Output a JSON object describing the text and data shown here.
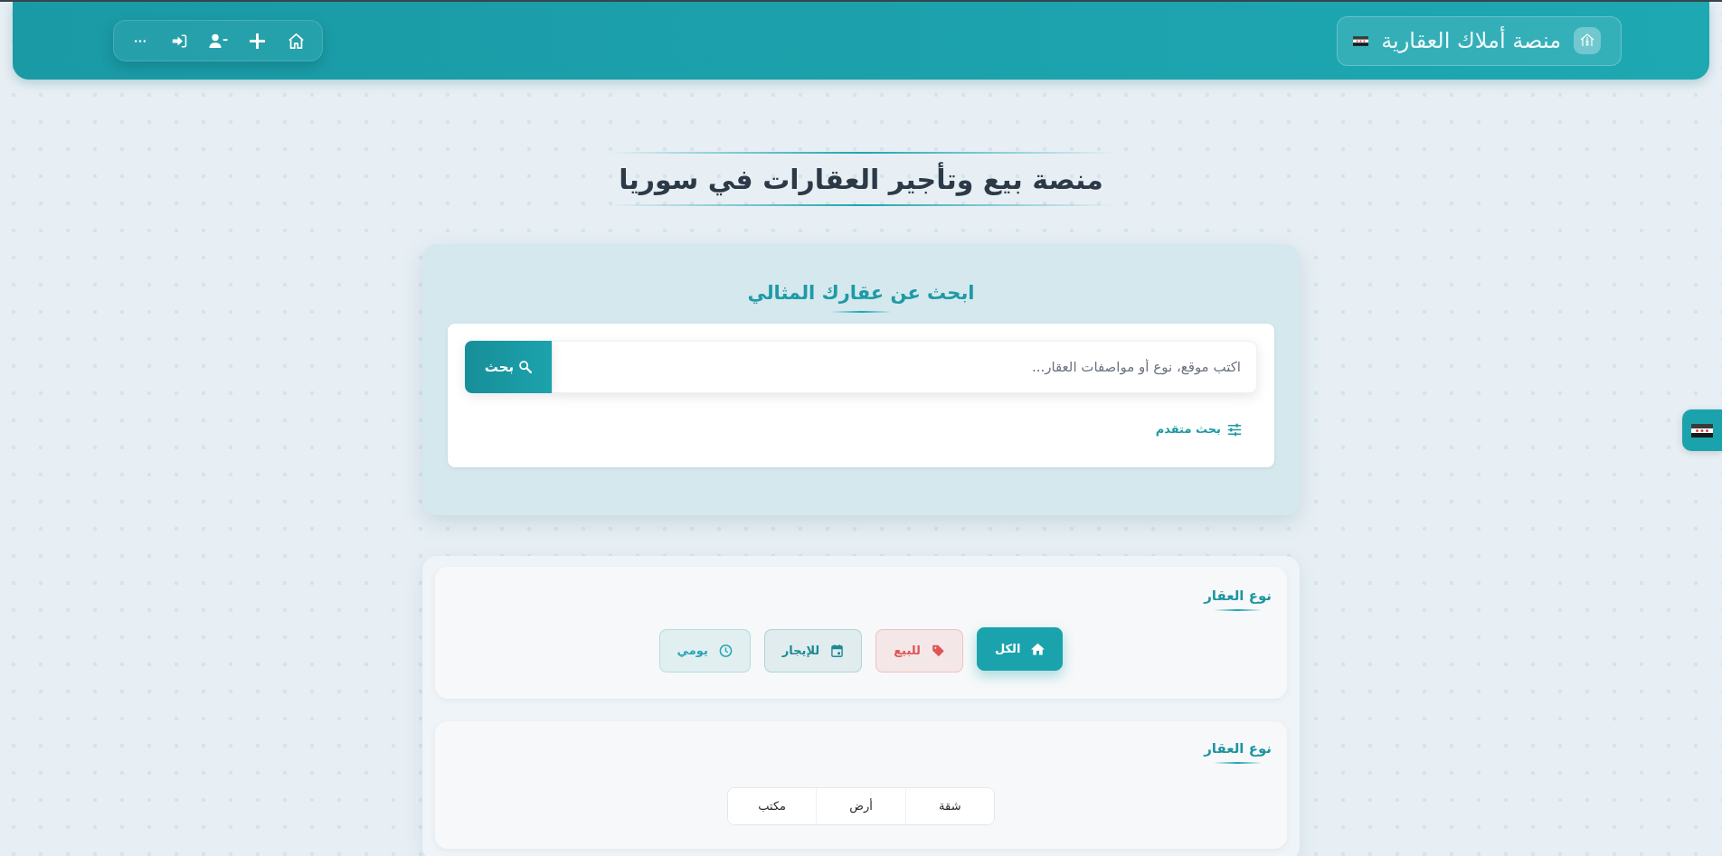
{
  "header": {
    "brand": "منصة أملاك العقارية"
  },
  "hero": {
    "title": "منصة بيع وتأجير العقارات في سوريا"
  },
  "search": {
    "heading": "ابحث عن عقارك المثالي",
    "placeholder": "اكتب موقع، نوع أو مواصفات العقار...",
    "button": "بحث",
    "advanced": "بحث متقدم"
  },
  "filters": [
    {
      "kind": "chips",
      "heading": "نوع العقار",
      "options": [
        {
          "label": "الكل",
          "selected": true,
          "color": "#1ba3ad"
        },
        {
          "label": "للبيع",
          "selected": false,
          "color": "#e05555"
        },
        {
          "label": "للإيجار",
          "selected": false,
          "color": "#1f8a95"
        },
        {
          "label": "يومي",
          "selected": false,
          "color": "#2aa5b5"
        }
      ]
    },
    {
      "kind": "segmented",
      "heading": "نوع العقار",
      "options": [
        {
          "label": "شقة",
          "selected": false
        },
        {
          "label": "أرض",
          "selected": false
        },
        {
          "label": "مكتب",
          "selected": false
        }
      ]
    }
  ]
}
